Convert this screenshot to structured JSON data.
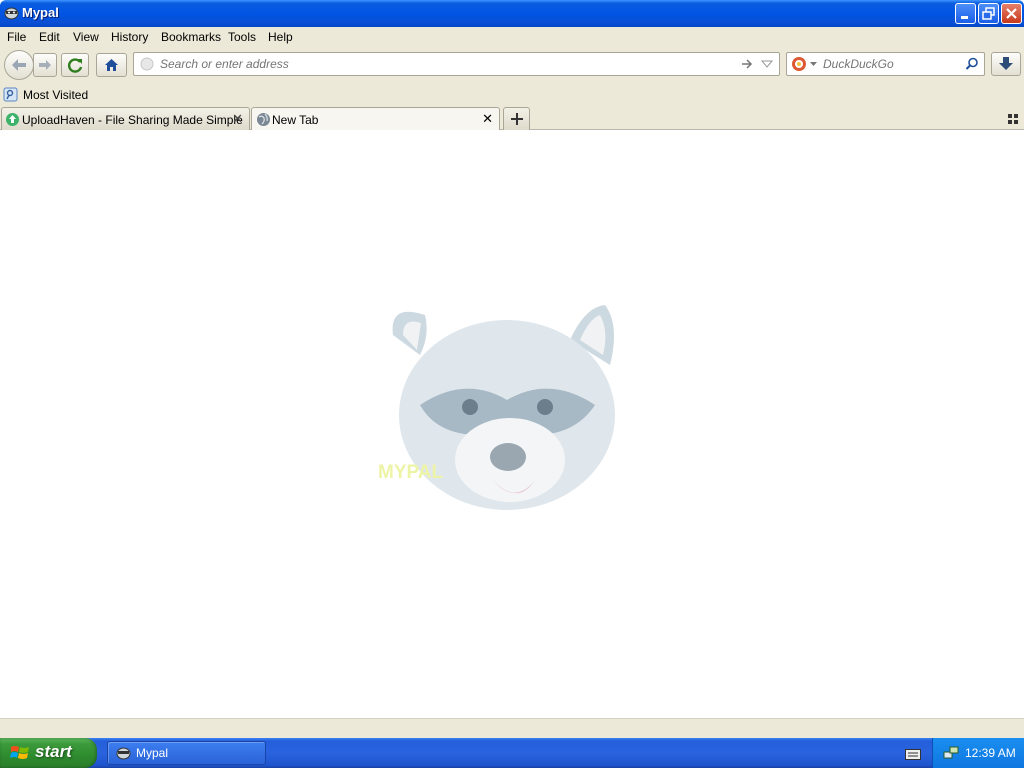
{
  "window": {
    "title": "Mypal"
  },
  "menu": [
    "File",
    "Edit",
    "View",
    "History",
    "Bookmarks",
    "Tools",
    "Help"
  ],
  "urlbar": {
    "placeholder": "Search or enter address"
  },
  "search": {
    "engine": "DuckDuckGo",
    "placeholder": "DuckDuckGo"
  },
  "bookmarks": {
    "most_visited": "Most Visited"
  },
  "tabs": [
    {
      "title": "UploadHaven - File Sharing Made Simple",
      "active": false
    },
    {
      "title": "New Tab",
      "active": true
    }
  ],
  "newtab": {
    "logo_text": "MYPAL"
  },
  "taskbar": {
    "start_label": "start",
    "window_label": "Mypal",
    "clock": "12:39 AM"
  },
  "colors": {
    "titlebar": "#0054e3",
    "chrome": "#ece9d8",
    "taskbar": "#245edb",
    "start": "#3c9a3c"
  }
}
